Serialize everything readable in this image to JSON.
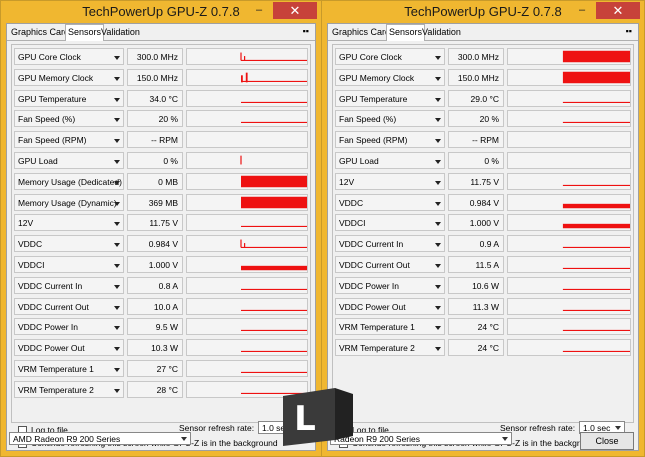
{
  "left": {
    "title": "TechPowerUp GPU-Z 0.7.8",
    "minimize": "–",
    "close": "✕",
    "tabs": [
      "Graphics Card",
      "Sensors",
      "Validation"
    ],
    "menu": "▪▪",
    "sensors": [
      {
        "name": "GPU Core Clock",
        "value": "300.0 MHz",
        "graph": "spike_line"
      },
      {
        "name": "GPU Memory Clock",
        "value": "150.0 MHz",
        "graph": "spike_line2"
      },
      {
        "name": "GPU Temperature",
        "value": "34.0 °C",
        "graph": "line"
      },
      {
        "name": "Fan Speed (%)",
        "value": "20 %",
        "graph": "line"
      },
      {
        "name": "Fan Speed (RPM)",
        "value": "-- RPM",
        "graph": "none"
      },
      {
        "name": "GPU Load",
        "value": "0 %",
        "graph": "tick"
      },
      {
        "name": "Memory Usage (Dedicated)",
        "value": "0 MB",
        "graph": "full"
      },
      {
        "name": "Memory Usage (Dynamic)",
        "value": "369 MB",
        "graph": "full"
      },
      {
        "name": "12V",
        "value": "11.75 V",
        "graph": "line"
      },
      {
        "name": "VDDC",
        "value": "0.984 V",
        "graph": "spike_line"
      },
      {
        "name": "VDDCI",
        "value": "1.000 V",
        "graph": "thick"
      },
      {
        "name": "VDDC Current In",
        "value": "0.8 A",
        "graph": "line"
      },
      {
        "name": "VDDC Current Out",
        "value": "10.0 A",
        "graph": "line"
      },
      {
        "name": "VDDC Power In",
        "value": "9.5 W",
        "graph": "line"
      },
      {
        "name": "VDDC Power Out",
        "value": "10.3 W",
        "graph": "line"
      },
      {
        "name": "VRM Temperature 1",
        "value": "27 °C",
        "graph": "line"
      },
      {
        "name": "VRM Temperature 2",
        "value": "28 °C",
        "graph": "line"
      }
    ],
    "log_label": "Log to file",
    "refresh_label": "Sensor refresh rate:",
    "refresh_value": "1.0 sec",
    "continue_label": "Continue refreshing this screen while GPU-Z is in the background",
    "gpu_select": "AMD Radeon R9 200 Series",
    "close_button": ""
  },
  "right": {
    "title": "TechPowerUp GPU-Z 0.7.8",
    "minimize": "–",
    "close": "✕",
    "tabs": [
      "Graphics Card",
      "Sensors",
      "Validation"
    ],
    "menu": "▪▪",
    "sensors": [
      {
        "name": "GPU Core Clock",
        "value": "300.0 MHz",
        "graph": "full"
      },
      {
        "name": "GPU Memory Clock",
        "value": "150.0 MHz",
        "graph": "full"
      },
      {
        "name": "GPU Temperature",
        "value": "29.0 °C",
        "graph": "line"
      },
      {
        "name": "Fan Speed (%)",
        "value": "20 %",
        "graph": "line"
      },
      {
        "name": "Fan Speed (RPM)",
        "value": "-- RPM",
        "graph": "none"
      },
      {
        "name": "GPU Load",
        "value": "0 %",
        "graph": "none"
      },
      {
        "name": "12V",
        "value": "11.75 V",
        "graph": "line"
      },
      {
        "name": "VDDC",
        "value": "0.984 V",
        "graph": "thick"
      },
      {
        "name": "VDDCI",
        "value": "1.000 V",
        "graph": "thick"
      },
      {
        "name": "VDDC Current In",
        "value": "0.9 A",
        "graph": "line"
      },
      {
        "name": "VDDC Current Out",
        "value": "11.5 A",
        "graph": "line"
      },
      {
        "name": "VDDC Power In",
        "value": "10.6 W",
        "graph": "line"
      },
      {
        "name": "VDDC Power Out",
        "value": "11.3 W",
        "graph": "line"
      },
      {
        "name": "VRM Temperature 1",
        "value": "24 °C",
        "graph": "line"
      },
      {
        "name": "VRM Temperature 2",
        "value": "24 °C",
        "graph": "line"
      }
    ],
    "log_label": "Log to file",
    "refresh_label": "Sensor refresh rate:",
    "refresh_value": "1.0 sec",
    "continue_label": "Continue refreshing this screen while GPU-Z is in the background",
    "gpu_select": "Radeon R9 200 Series",
    "close_button": "Close"
  },
  "colors": {
    "graph": "#ee1111",
    "titlebar": "#f0b730",
    "close": "#c7423a"
  }
}
